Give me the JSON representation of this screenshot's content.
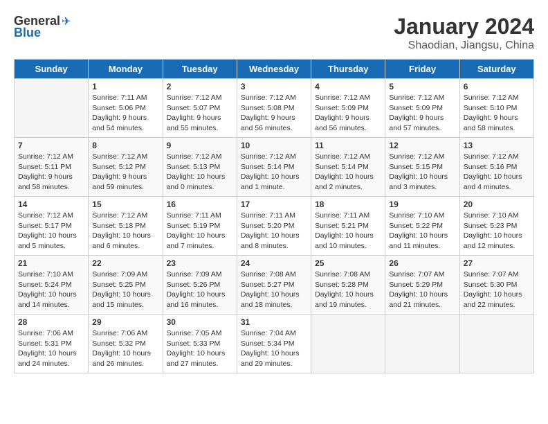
{
  "header": {
    "logo_general": "General",
    "logo_blue": "Blue",
    "title": "January 2024",
    "subtitle": "Shaodian, Jiangsu, China"
  },
  "days_of_week": [
    "Sunday",
    "Monday",
    "Tuesday",
    "Wednesday",
    "Thursday",
    "Friday",
    "Saturday"
  ],
  "weeks": [
    [
      {
        "day": "",
        "empty": true
      },
      {
        "day": "1",
        "sunrise": "Sunrise: 7:11 AM",
        "sunset": "Sunset: 5:06 PM",
        "daylight": "Daylight: 9 hours and 54 minutes."
      },
      {
        "day": "2",
        "sunrise": "Sunrise: 7:12 AM",
        "sunset": "Sunset: 5:07 PM",
        "daylight": "Daylight: 9 hours and 55 minutes."
      },
      {
        "day": "3",
        "sunrise": "Sunrise: 7:12 AM",
        "sunset": "Sunset: 5:08 PM",
        "daylight": "Daylight: 9 hours and 56 minutes."
      },
      {
        "day": "4",
        "sunrise": "Sunrise: 7:12 AM",
        "sunset": "Sunset: 5:09 PM",
        "daylight": "Daylight: 9 hours and 56 minutes."
      },
      {
        "day": "5",
        "sunrise": "Sunrise: 7:12 AM",
        "sunset": "Sunset: 5:09 PM",
        "daylight": "Daylight: 9 hours and 57 minutes."
      },
      {
        "day": "6",
        "sunrise": "Sunrise: 7:12 AM",
        "sunset": "Sunset: 5:10 PM",
        "daylight": "Daylight: 9 hours and 58 minutes."
      }
    ],
    [
      {
        "day": "7",
        "sunrise": "Sunrise: 7:12 AM",
        "sunset": "Sunset: 5:11 PM",
        "daylight": "Daylight: 9 hours and 58 minutes."
      },
      {
        "day": "8",
        "sunrise": "Sunrise: 7:12 AM",
        "sunset": "Sunset: 5:12 PM",
        "daylight": "Daylight: 9 hours and 59 minutes."
      },
      {
        "day": "9",
        "sunrise": "Sunrise: 7:12 AM",
        "sunset": "Sunset: 5:13 PM",
        "daylight": "Daylight: 10 hours and 0 minutes."
      },
      {
        "day": "10",
        "sunrise": "Sunrise: 7:12 AM",
        "sunset": "Sunset: 5:14 PM",
        "daylight": "Daylight: 10 hours and 1 minute."
      },
      {
        "day": "11",
        "sunrise": "Sunrise: 7:12 AM",
        "sunset": "Sunset: 5:14 PM",
        "daylight": "Daylight: 10 hours and 2 minutes."
      },
      {
        "day": "12",
        "sunrise": "Sunrise: 7:12 AM",
        "sunset": "Sunset: 5:15 PM",
        "daylight": "Daylight: 10 hours and 3 minutes."
      },
      {
        "day": "13",
        "sunrise": "Sunrise: 7:12 AM",
        "sunset": "Sunset: 5:16 PM",
        "daylight": "Daylight: 10 hours and 4 minutes."
      }
    ],
    [
      {
        "day": "14",
        "sunrise": "Sunrise: 7:12 AM",
        "sunset": "Sunset: 5:17 PM",
        "daylight": "Daylight: 10 hours and 5 minutes."
      },
      {
        "day": "15",
        "sunrise": "Sunrise: 7:12 AM",
        "sunset": "Sunset: 5:18 PM",
        "daylight": "Daylight: 10 hours and 6 minutes."
      },
      {
        "day": "16",
        "sunrise": "Sunrise: 7:11 AM",
        "sunset": "Sunset: 5:19 PM",
        "daylight": "Daylight: 10 hours and 7 minutes."
      },
      {
        "day": "17",
        "sunrise": "Sunrise: 7:11 AM",
        "sunset": "Sunset: 5:20 PM",
        "daylight": "Daylight: 10 hours and 8 minutes."
      },
      {
        "day": "18",
        "sunrise": "Sunrise: 7:11 AM",
        "sunset": "Sunset: 5:21 PM",
        "daylight": "Daylight: 10 hours and 10 minutes."
      },
      {
        "day": "19",
        "sunrise": "Sunrise: 7:10 AM",
        "sunset": "Sunset: 5:22 PM",
        "daylight": "Daylight: 10 hours and 11 minutes."
      },
      {
        "day": "20",
        "sunrise": "Sunrise: 7:10 AM",
        "sunset": "Sunset: 5:23 PM",
        "daylight": "Daylight: 10 hours and 12 minutes."
      }
    ],
    [
      {
        "day": "21",
        "sunrise": "Sunrise: 7:10 AM",
        "sunset": "Sunset: 5:24 PM",
        "daylight": "Daylight: 10 hours and 14 minutes."
      },
      {
        "day": "22",
        "sunrise": "Sunrise: 7:09 AM",
        "sunset": "Sunset: 5:25 PM",
        "daylight": "Daylight: 10 hours and 15 minutes."
      },
      {
        "day": "23",
        "sunrise": "Sunrise: 7:09 AM",
        "sunset": "Sunset: 5:26 PM",
        "daylight": "Daylight: 10 hours and 16 minutes."
      },
      {
        "day": "24",
        "sunrise": "Sunrise: 7:08 AM",
        "sunset": "Sunset: 5:27 PM",
        "daylight": "Daylight: 10 hours and 18 minutes."
      },
      {
        "day": "25",
        "sunrise": "Sunrise: 7:08 AM",
        "sunset": "Sunset: 5:28 PM",
        "daylight": "Daylight: 10 hours and 19 minutes."
      },
      {
        "day": "26",
        "sunrise": "Sunrise: 7:07 AM",
        "sunset": "Sunset: 5:29 PM",
        "daylight": "Daylight: 10 hours and 21 minutes."
      },
      {
        "day": "27",
        "sunrise": "Sunrise: 7:07 AM",
        "sunset": "Sunset: 5:30 PM",
        "daylight": "Daylight: 10 hours and 22 minutes."
      }
    ],
    [
      {
        "day": "28",
        "sunrise": "Sunrise: 7:06 AM",
        "sunset": "Sunset: 5:31 PM",
        "daylight": "Daylight: 10 hours and 24 minutes."
      },
      {
        "day": "29",
        "sunrise": "Sunrise: 7:06 AM",
        "sunset": "Sunset: 5:32 PM",
        "daylight": "Daylight: 10 hours and 26 minutes."
      },
      {
        "day": "30",
        "sunrise": "Sunrise: 7:05 AM",
        "sunset": "Sunset: 5:33 PM",
        "daylight": "Daylight: 10 hours and 27 minutes."
      },
      {
        "day": "31",
        "sunrise": "Sunrise: 7:04 AM",
        "sunset": "Sunset: 5:34 PM",
        "daylight": "Daylight: 10 hours and 29 minutes."
      },
      {
        "day": "",
        "empty": true
      },
      {
        "day": "",
        "empty": true
      },
      {
        "day": "",
        "empty": true
      }
    ]
  ]
}
